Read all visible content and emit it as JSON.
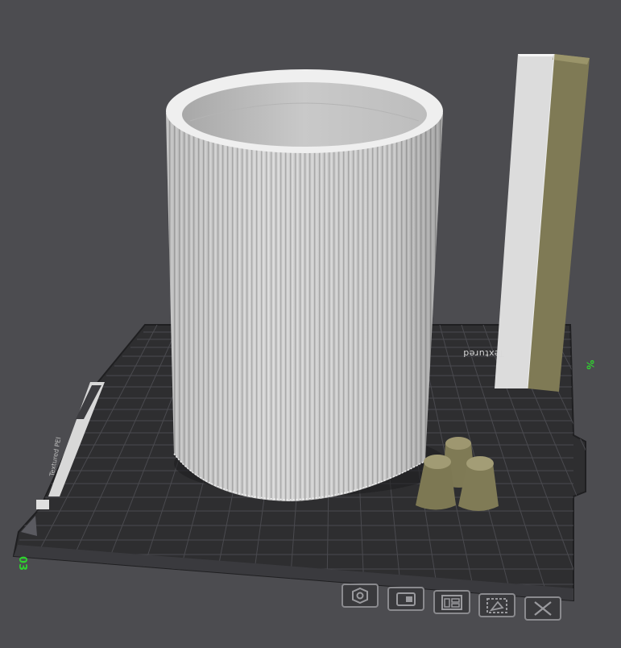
{
  "viewport": {
    "plate_number": "03",
    "corner_mark": "%",
    "bed_texture_text": "Textured",
    "bed_side_text": "Textured PEI"
  },
  "toolbar": {
    "buttons": [
      {
        "name": "settings",
        "icon": "gear-icon"
      },
      {
        "name": "import",
        "icon": "import-icon"
      },
      {
        "name": "arrange",
        "icon": "arrange-icon"
      },
      {
        "name": "cut",
        "icon": "cut-icon"
      },
      {
        "name": "delete",
        "icon": "delete-icon"
      }
    ]
  },
  "colors": {
    "background": "#4c4c50",
    "bed": "#2e2e30",
    "bed_grid": "#55555a",
    "model_white": "#d4d4d4",
    "model_olive": "#7f7a55",
    "plate_label": "#2fd22f"
  }
}
